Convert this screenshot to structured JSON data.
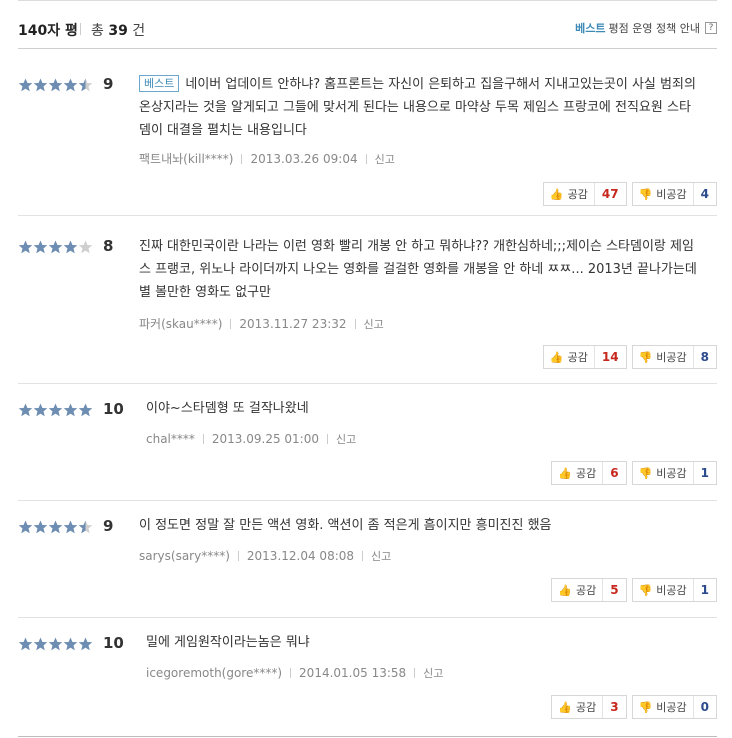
{
  "header": {
    "title": "140자 평",
    "total_prefix": "총",
    "total_count": "39",
    "total_suffix": "건",
    "best_label": "베스트",
    "policy_label": "평점 운영 정책 안내",
    "help_label": "?"
  },
  "labels": {
    "like": "공감",
    "dislike": "비공감",
    "report": "신고",
    "best_badge": "베스트"
  },
  "colors": {
    "star": "#6d8eb2",
    "star_empty": "#cfcfcf",
    "like_count": "#c6281d",
    "dislike_count": "#2c4b8c",
    "accent": "#3d8ab7"
  },
  "reviews": [
    {
      "score": "9",
      "stars": 4.5,
      "best": true,
      "text": "네이버 업데이트 안하냐? 홈프론트는 자신이 은퇴하고 집을구해서 지내고있는곳이 사실 범죄의 온상지라는 것을 알게되고 그들에 맞서게 된다는 내용으로 마약상 두목 제임스 프랑코에 전직요원 스타뎀이 대결을 펼치는 내용입니다",
      "author": "팩트내놔(kill****)",
      "date": "2013.03.26 09:04",
      "likes": "47",
      "dislikes": "4"
    },
    {
      "score": "8",
      "stars": 4,
      "best": false,
      "text": "진짜 대한민국이란 나라는 이런 영화 빨리 개봉 안 하고 뭐하냐?? 개한심하네;;;제이슨 스타뎀이랑 제임스 프랭코, 위노나 라이더까지 나오는 영화를 걸걸한 영화를 개봉을 안 하네 ㅉㅉ... 2013년 끝나가는데 별 볼만한 영화도 없구만",
      "author": "파커(skau****)",
      "date": "2013.11.27 23:32",
      "likes": "14",
      "dislikes": "8"
    },
    {
      "score": "10",
      "stars": 5,
      "best": false,
      "text": "이야~스타뎀형 또 걸작나왔네",
      "author": "chal****",
      "date": "2013.09.25 01:00",
      "likes": "6",
      "dislikes": "1"
    },
    {
      "score": "9",
      "stars": 4.5,
      "best": false,
      "text": "이 정도면 정말 잘 만든 액션 영화. 액션이 좀 적은게 흠이지만 흥미진진 했음",
      "author": "sarys(sary****)",
      "date": "2013.12.04 08:08",
      "likes": "5",
      "dislikes": "1"
    },
    {
      "score": "10",
      "stars": 5,
      "best": false,
      "text": "밀에 게임원작이라는놈은 뭐냐",
      "author": "icegoremoth(gore****)",
      "date": "2014.01.05 13:58",
      "likes": "3",
      "dislikes": "0"
    }
  ]
}
